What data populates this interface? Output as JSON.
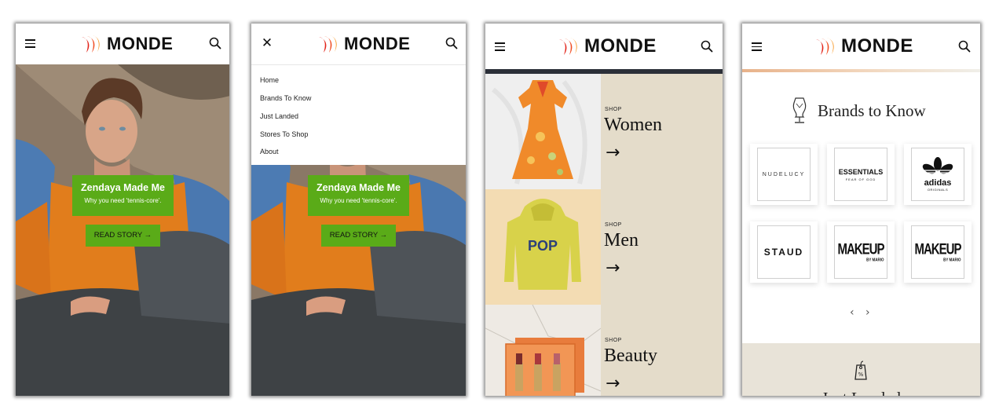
{
  "brand": {
    "name": "MONDE"
  },
  "hero": {
    "title": "Zendaya Made Me",
    "subtitle": "Why you need 'tennis-core'.",
    "cta": "READ STORY →"
  },
  "nav": {
    "items": [
      "Home",
      "Brands To Know",
      "Just Landed",
      "Stores To Shop",
      "About"
    ]
  },
  "shop": {
    "label": "SHOP",
    "arrow": "→",
    "categories": [
      "Women",
      "Men",
      "Beauty"
    ],
    "hoodie_text": "POP"
  },
  "brands_section": {
    "title": "Brands to Know",
    "nudelucy": "NUDELUCY",
    "essentials": "ESSENTIALS",
    "essentials_sub": "FEAR OF GOD",
    "adidas": "adidas",
    "adidas_sub": "ORIGINALS",
    "staud": "STAUD",
    "makeup": "MAKEUP",
    "makeup_sub": "BY MARIO",
    "prev": "‹",
    "next": "›"
  },
  "just_landed": {
    "title": "Just Landed"
  },
  "colors": {
    "accent_green": "#5aab18",
    "shop_panel": "#e4dcca",
    "brand_red": "#e2231a",
    "brand_orange": "#f7941d"
  }
}
